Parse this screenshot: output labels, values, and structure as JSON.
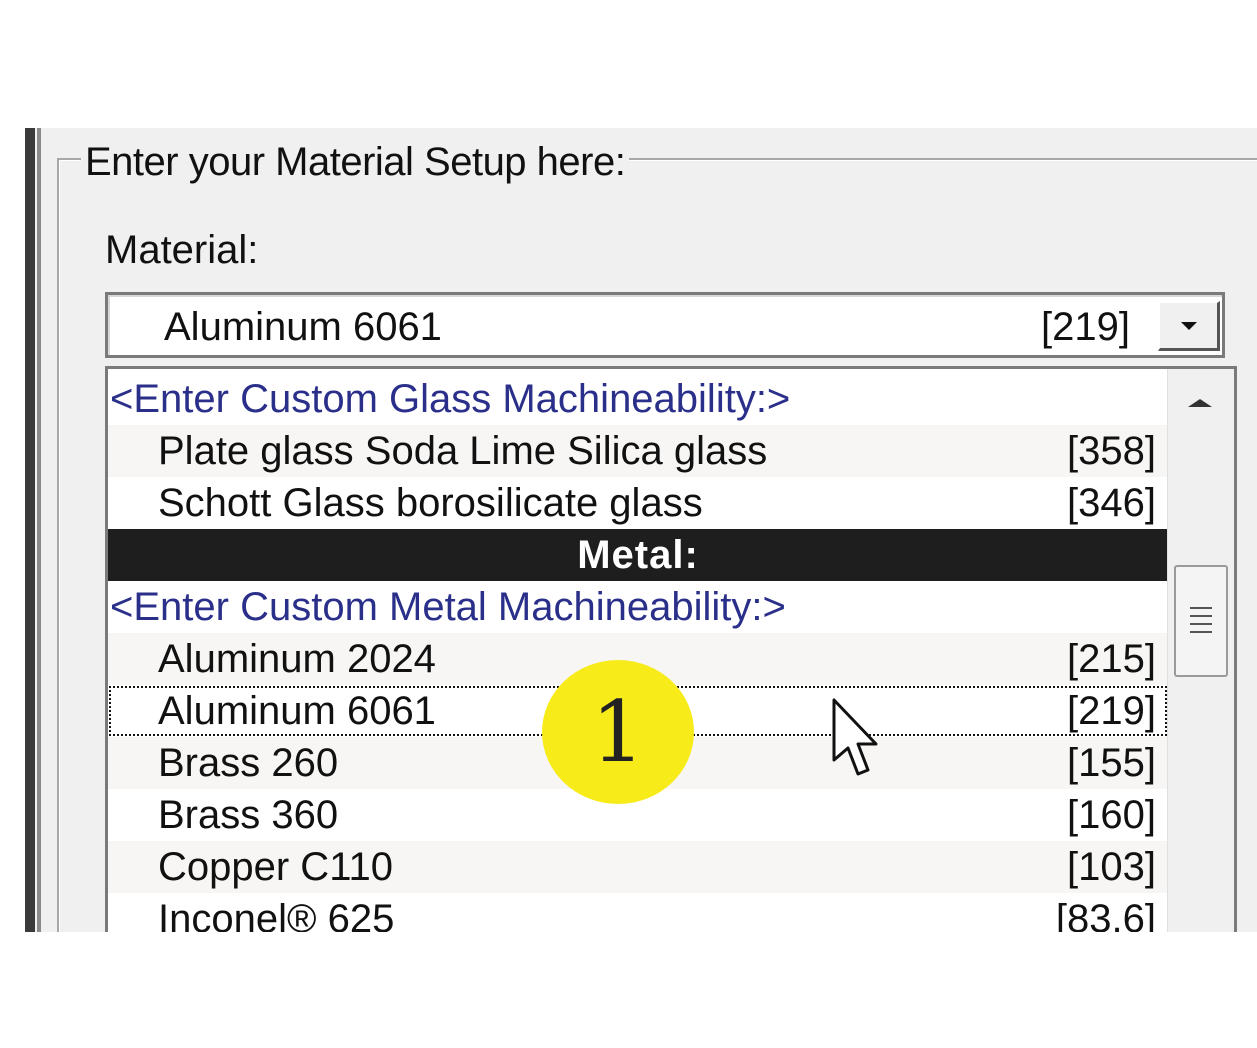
{
  "group": {
    "title": "Enter your Material Setup here:"
  },
  "material": {
    "label": "Material:",
    "selected_name": "Aluminum 6061",
    "selected_code": "[219]"
  },
  "list": {
    "rows": [
      {
        "type": "custom",
        "name": "<Enter Custom Glass Machineability:>",
        "code": ""
      },
      {
        "type": "item",
        "name": "Plate glass Soda Lime Silica glass",
        "code": "[358]"
      },
      {
        "type": "item",
        "name": "Schott Glass borosilicate glass",
        "code": "[346]"
      },
      {
        "type": "header",
        "name": "Metal:",
        "code": ""
      },
      {
        "type": "custom",
        "name": "<Enter Custom Metal Machineability:>",
        "code": ""
      },
      {
        "type": "item",
        "name": "Aluminum 2024",
        "code": "[215]"
      },
      {
        "type": "item",
        "name": "Aluminum 6061",
        "code": "[219]",
        "focused": true
      },
      {
        "type": "item",
        "name": "Brass 260",
        "code": "[155]"
      },
      {
        "type": "item",
        "name": "Brass 360",
        "code": "[160]"
      },
      {
        "type": "item",
        "name": "Copper C110",
        "code": "[103]"
      },
      {
        "type": "item",
        "name": "Inconel® 625",
        "code": "[83.6]"
      }
    ]
  },
  "annotation": {
    "marker_text": "1",
    "marker_color": "#f7eb1a"
  },
  "icons": {
    "dropdown": "chevron-down-icon",
    "scroll_up": "scroll-up-arrow-icon",
    "cursor": "mouse-pointer-icon"
  }
}
